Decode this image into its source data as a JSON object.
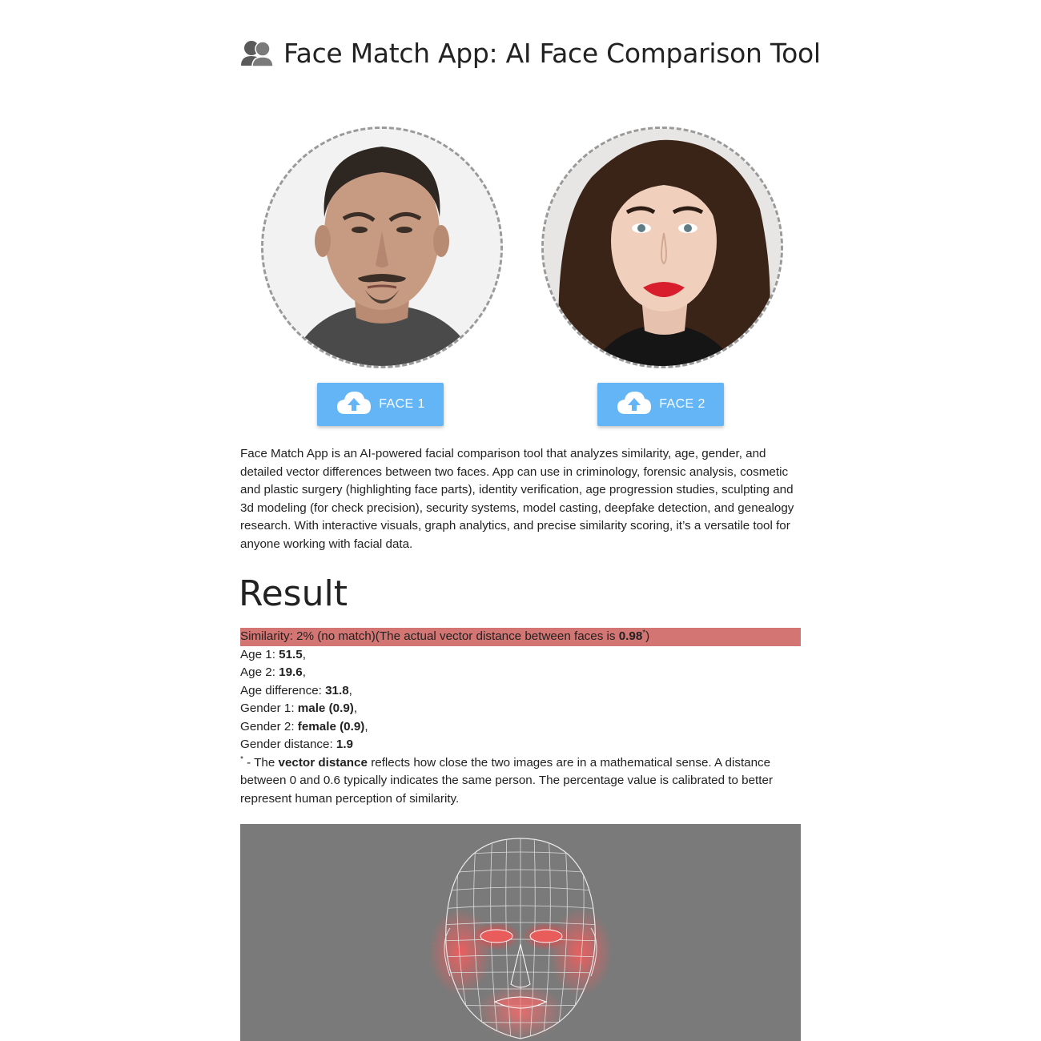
{
  "header": {
    "title_icon": "two-people-icon",
    "title": "Face Match App: AI Face Comparison Tool"
  },
  "faces": [
    {
      "button_label": "FACE 1",
      "button_icon": "cloud-upload-icon"
    },
    {
      "button_label": "FACE 2",
      "button_icon": "cloud-upload-icon"
    }
  ],
  "description": "Face Match App is an AI-powered facial comparison tool that analyzes similarity, age, gender, and detailed vector differences between two faces. App can use in criminology, forensic analysis, cosmetic and plastic surgery (highlighting face parts), identity verification, age progression studies, sculpting and 3d modeling (for check precision), security systems, model casting, deepfake detection, and genealogy research. With interactive visuals, graph analytics, and precise similarity scoring, it’s a versatile tool for anyone working with facial data.",
  "result": {
    "heading": "Result",
    "similarity_prefix": "Similarity: 2% (no match)(The actual vector distance between faces is ",
    "similarity_distance": "0.98",
    "similarity_star": "*",
    "similarity_suffix": ")",
    "age1_label": "Age 1: ",
    "age1_value": "51.5",
    "age2_label": "Age 2: ",
    "age2_value": "19.6",
    "age_diff_label": "Age difference: ",
    "age_diff_value": "31.8",
    "gender1_label": "Gender 1: ",
    "gender1_value": "male (0.9)",
    "gender2_label": "Gender 2: ",
    "gender2_value": "female (0.9)",
    "gender_distance_label": "Gender distance: ",
    "gender_distance_value": "1.9",
    "comma": ",",
    "footnote_star": "*",
    "footnote_prefix": " - The ",
    "footnote_bold": "vector distance",
    "footnote_rest": " reflects how close the two images are in a mathematical sense. A distance between 0 and 0.6 typically indicates the same person. The percentage value is calibrated to better represent human perception of similarity.",
    "similarity_bar_color": "#d37573"
  },
  "colors": {
    "button": "#64b5f6",
    "mesh_background": "#7a7a7a",
    "mesh_highlight": "#ff5050"
  }
}
